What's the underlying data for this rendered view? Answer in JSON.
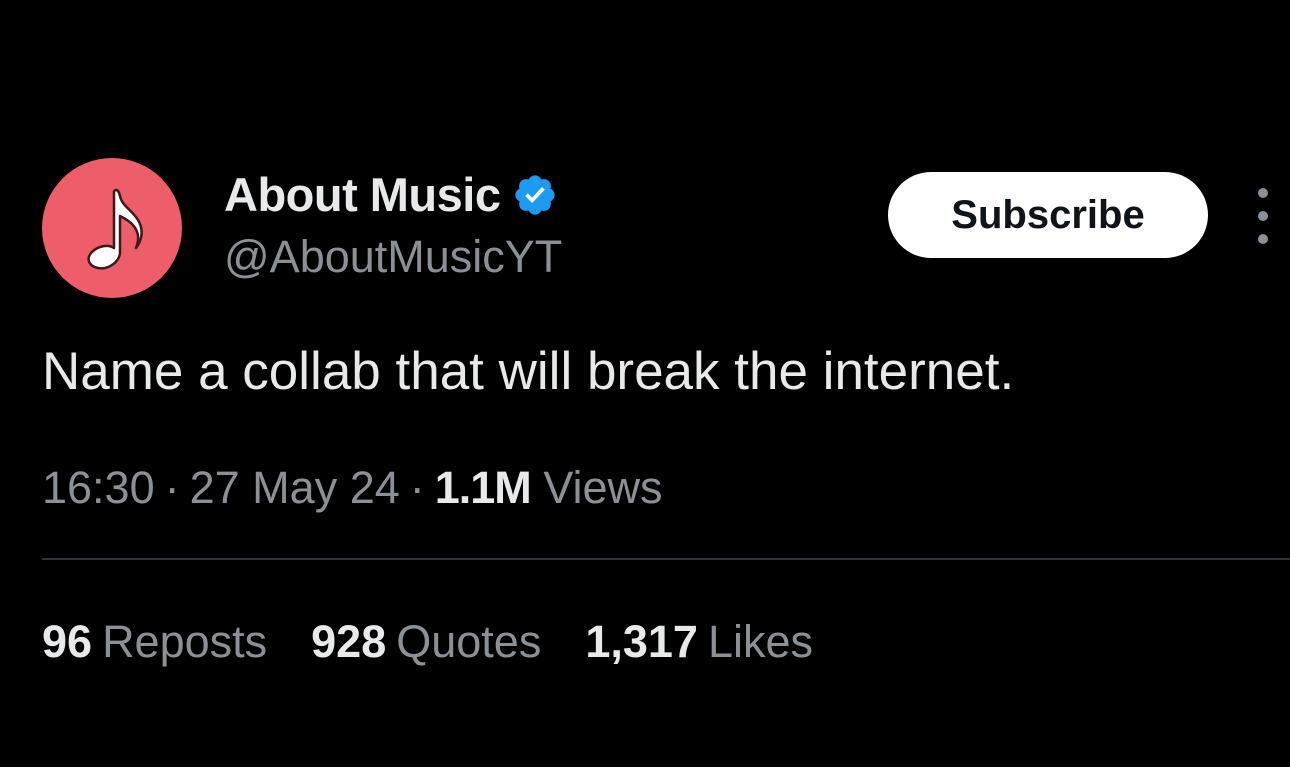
{
  "author": {
    "display_name": "About Music",
    "handle": "@AboutMusicYT",
    "verified_icon": "verified-badge-icon",
    "avatar_icon": "music-note-icon",
    "avatar_color": "#ee5d6a"
  },
  "actions": {
    "subscribe_label": "Subscribe",
    "more_icon": "more-vertical-icon"
  },
  "tweet": {
    "text": "Name a collab that will break the internet.",
    "time": "16:30",
    "date": "27 May 24",
    "views_count": "1.1M",
    "views_label": "Views",
    "separator": "·"
  },
  "stats": [
    {
      "count": "96",
      "label": "Reposts"
    },
    {
      "count": "928",
      "label": "Quotes"
    },
    {
      "count": "1,317",
      "label": "Likes"
    }
  ],
  "colors": {
    "background": "#000000",
    "primary_text": "#e7e9ea",
    "secondary_text": "#8b9096",
    "verified_blue": "#1d9bf0",
    "divider": "#2f3336"
  }
}
